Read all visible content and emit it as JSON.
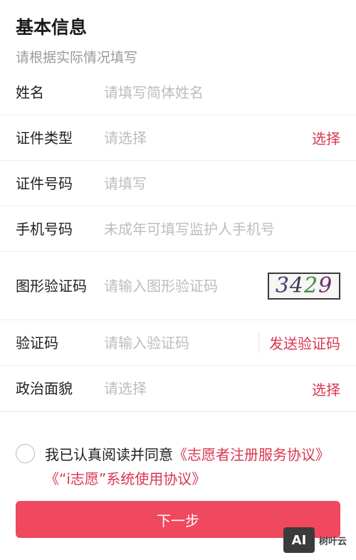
{
  "header": {
    "title": "基本信息",
    "subtitle": "请根据实际情况填写"
  },
  "fields": {
    "name": {
      "label": "姓名",
      "placeholder": "请填写简体姓名"
    },
    "id_type": {
      "label": "证件类型",
      "placeholder": "请选择",
      "action": "选择"
    },
    "id_number": {
      "label": "证件号码",
      "placeholder": "请填写"
    },
    "phone": {
      "label": "手机号码",
      "placeholder": "未成年可填写监护人手机号"
    },
    "captcha": {
      "label": "图形验证码",
      "placeholder": "请输入图形验证码",
      "image_text": [
        "3",
        "4",
        "2",
        "9"
      ]
    },
    "sms_code": {
      "label": "验证码",
      "placeholder": "请输入验证码",
      "action": "发送验证码"
    },
    "political": {
      "label": "政治面貌",
      "placeholder": "请选择",
      "action": "选择"
    }
  },
  "agreement": {
    "prefix": "我已认真阅读并同意",
    "link1": "《志愿者注册服务协议》",
    "link2": "《“i志愿”系统使用协议》"
  },
  "next_button": "下一步",
  "watermark": {
    "logo": "AI",
    "text": "树叶云"
  },
  "colors": {
    "accent": "#d9364f",
    "button": "#f0485e",
    "placeholder": "#bdbdbd"
  }
}
